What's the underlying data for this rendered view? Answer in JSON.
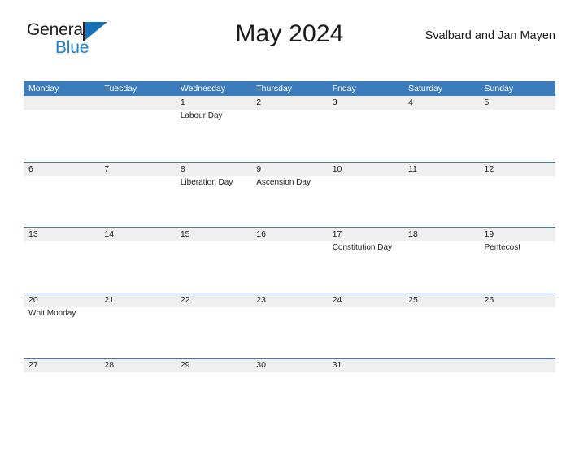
{
  "brand": {
    "name_part1": "General",
    "name_part2": "Blue",
    "mark": "flag-triangle"
  },
  "header": {
    "title": "May 2024",
    "locale": "Svalbard and Jan Mayen"
  },
  "colors": {
    "header_blue": "#3c7cba",
    "band_gray": "#efefef",
    "brand_blue": "#1d7fc3",
    "text_dark": "#222222"
  },
  "calendar": {
    "weekdays": [
      "Monday",
      "Tuesday",
      "Wednesday",
      "Thursday",
      "Friday",
      "Saturday",
      "Sunday"
    ],
    "weeks": [
      [
        {
          "day": "",
          "event": ""
        },
        {
          "day": "",
          "event": ""
        },
        {
          "day": "1",
          "event": "Labour Day"
        },
        {
          "day": "2",
          "event": ""
        },
        {
          "day": "3",
          "event": ""
        },
        {
          "day": "4",
          "event": ""
        },
        {
          "day": "5",
          "event": ""
        }
      ],
      [
        {
          "day": "6",
          "event": ""
        },
        {
          "day": "7",
          "event": ""
        },
        {
          "day": "8",
          "event": "Liberation Day"
        },
        {
          "day": "9",
          "event": "Ascension Day"
        },
        {
          "day": "10",
          "event": ""
        },
        {
          "day": "11",
          "event": ""
        },
        {
          "day": "12",
          "event": ""
        }
      ],
      [
        {
          "day": "13",
          "event": ""
        },
        {
          "day": "14",
          "event": ""
        },
        {
          "day": "15",
          "event": ""
        },
        {
          "day": "16",
          "event": ""
        },
        {
          "day": "17",
          "event": "Constitution Day"
        },
        {
          "day": "18",
          "event": ""
        },
        {
          "day": "19",
          "event": "Pentecost"
        }
      ],
      [
        {
          "day": "20",
          "event": "Whit Monday"
        },
        {
          "day": "21",
          "event": ""
        },
        {
          "day": "22",
          "event": ""
        },
        {
          "day": "23",
          "event": ""
        },
        {
          "day": "24",
          "event": ""
        },
        {
          "day": "25",
          "event": ""
        },
        {
          "day": "26",
          "event": ""
        }
      ],
      [
        {
          "day": "27",
          "event": ""
        },
        {
          "day": "28",
          "event": ""
        },
        {
          "day": "29",
          "event": ""
        },
        {
          "day": "30",
          "event": ""
        },
        {
          "day": "31",
          "event": ""
        },
        {
          "day": "",
          "event": ""
        },
        {
          "day": "",
          "event": ""
        }
      ]
    ]
  }
}
